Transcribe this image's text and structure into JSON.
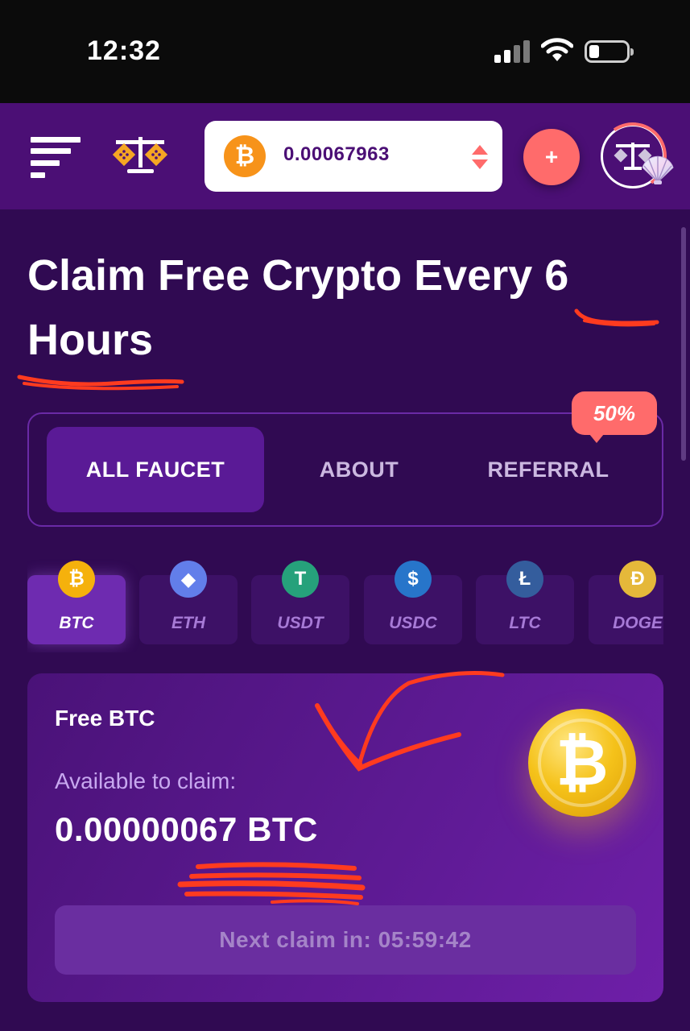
{
  "status_bar": {
    "time": "12:32"
  },
  "header": {
    "balance": "0.00067963",
    "add_label": "+",
    "coin_symbol": "₿"
  },
  "main": {
    "title": "Claim Free Crypto Every 6 Hours",
    "tabs": [
      {
        "label": "ALL FAUCET",
        "active": true
      },
      {
        "label": "ABOUT",
        "active": false
      },
      {
        "label": "REFERRAL",
        "active": false
      }
    ],
    "referral_badge": "50%",
    "coins": [
      {
        "label": "BTC",
        "active": true,
        "color": "#f5b10c",
        "glyph": "₿"
      },
      {
        "label": "ETH",
        "active": false,
        "color": "#627eea",
        "glyph": "◆"
      },
      {
        "label": "USDT",
        "active": false,
        "color": "#26a17b",
        "glyph": "T"
      },
      {
        "label": "USDC",
        "active": false,
        "color": "#2775ca",
        "glyph": "$"
      },
      {
        "label": "LTC",
        "active": false,
        "color": "#345d9d",
        "glyph": "Ł"
      },
      {
        "label": "DOGE",
        "active": false,
        "color": "#e5b83a",
        "glyph": "Ð"
      }
    ],
    "card": {
      "title": "Free BTC",
      "available_label": "Available to claim:",
      "available_value": "0.00000067 BTC",
      "coin_glyph": "₿",
      "button_label": "Next claim in: 05:59:42"
    }
  },
  "colors": {
    "background": "#300a52",
    "header": "#4b0f75",
    "accent": "#ff6b6b",
    "bitcoin": "#f7931a"
  }
}
